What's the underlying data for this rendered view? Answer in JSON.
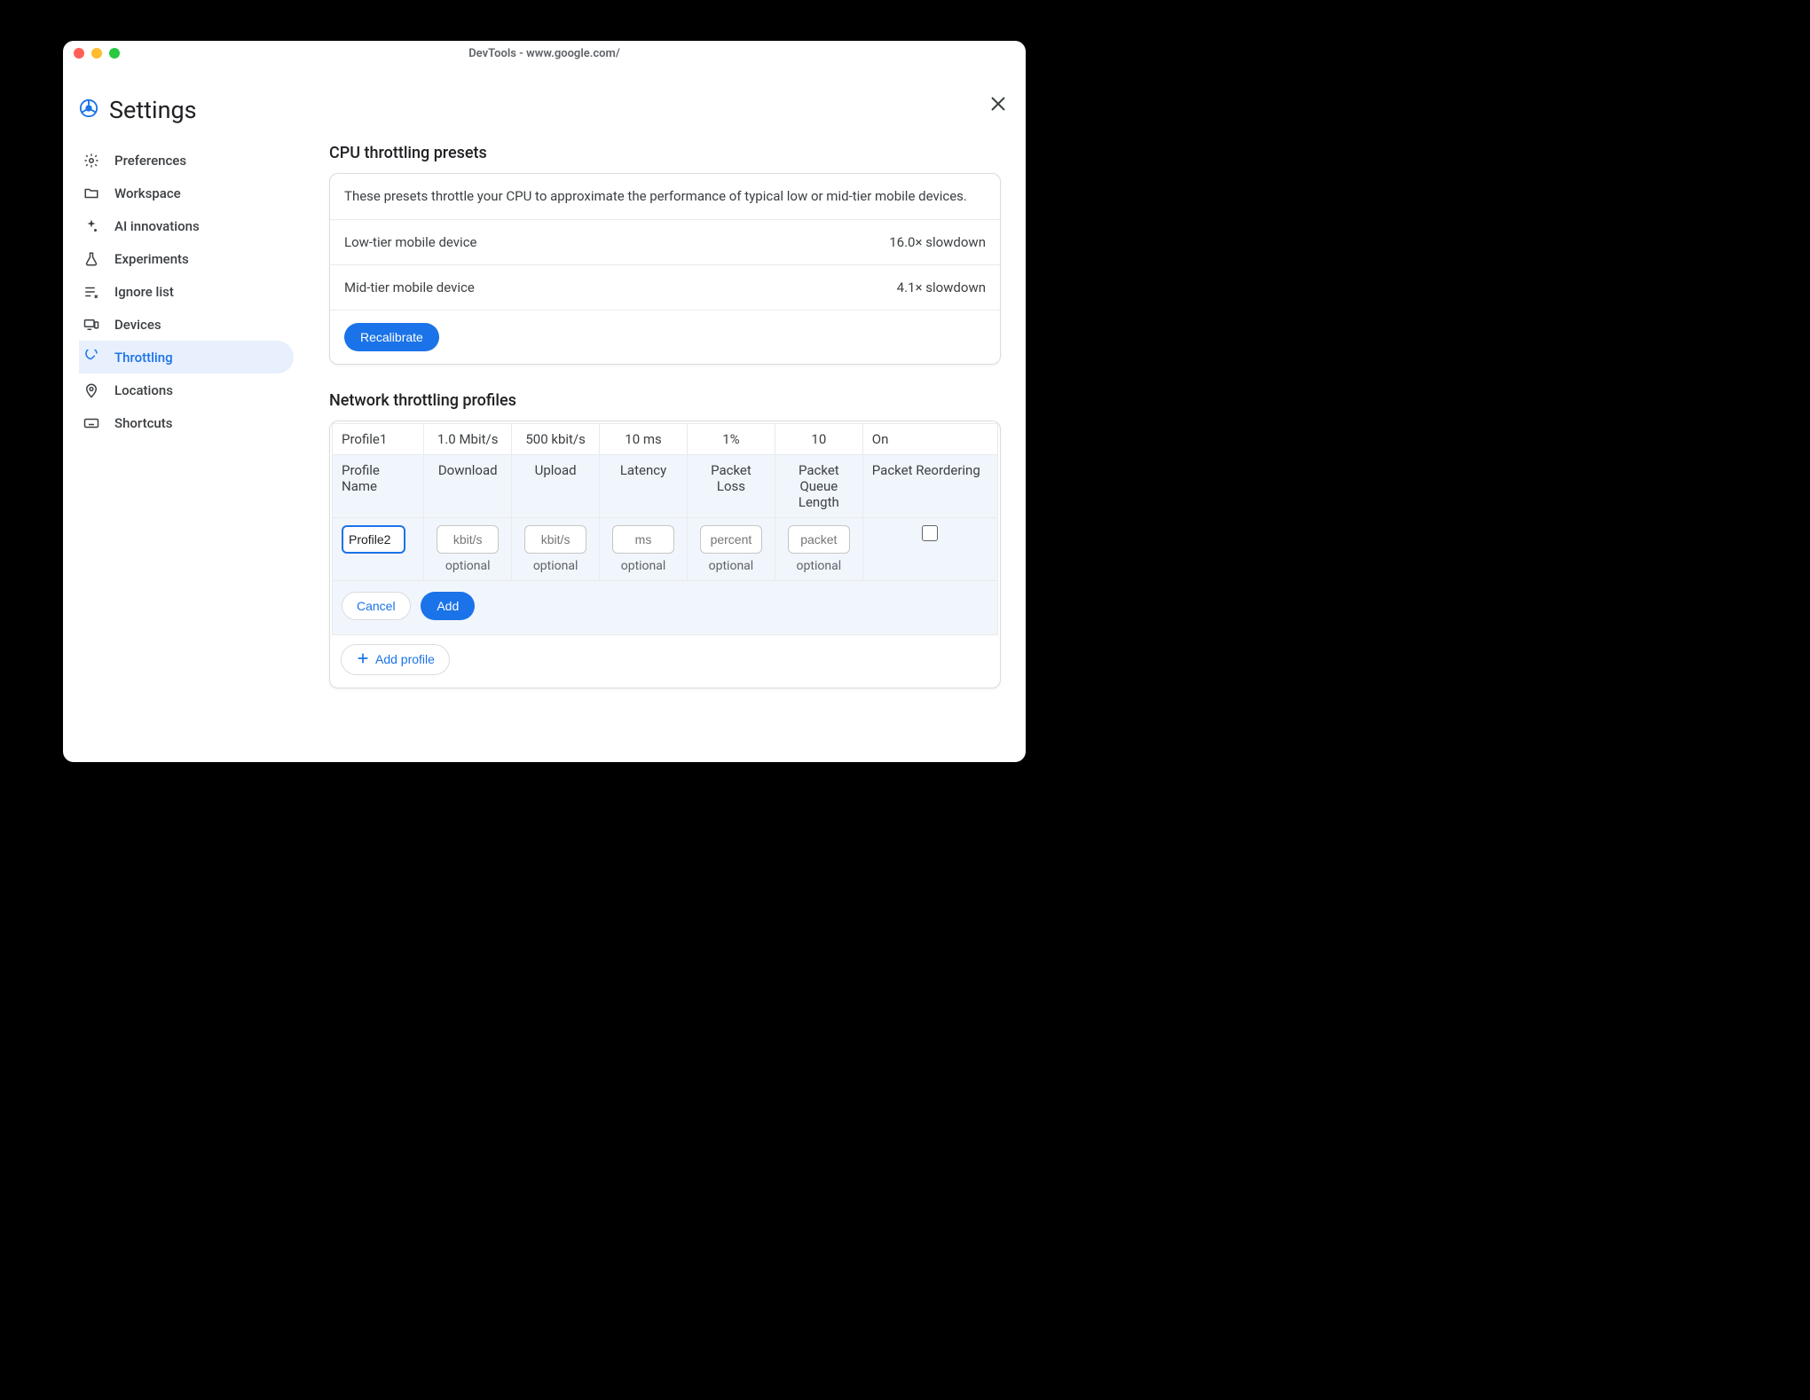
{
  "window": {
    "title": "DevTools - www.google.com/"
  },
  "header": {
    "title": "Settings"
  },
  "sidebar": {
    "items": [
      {
        "label": "Preferences",
        "active": false
      },
      {
        "label": "Workspace",
        "active": false
      },
      {
        "label": "AI innovations",
        "active": false
      },
      {
        "label": "Experiments",
        "active": false
      },
      {
        "label": "Ignore list",
        "active": false
      },
      {
        "label": "Devices",
        "active": false
      },
      {
        "label": "Throttling",
        "active": true
      },
      {
        "label": "Locations",
        "active": false
      },
      {
        "label": "Shortcuts",
        "active": false
      }
    ]
  },
  "cpu": {
    "title": "CPU throttling presets",
    "intro": "These presets throttle your CPU to approximate the performance of typical low or mid-tier mobile devices.",
    "rows": [
      {
        "name": "Low-tier mobile device",
        "value": "16.0× slowdown"
      },
      {
        "name": "Mid-tier mobile device",
        "value": "4.1× slowdown"
      }
    ],
    "recalibrate": "Recalibrate"
  },
  "network": {
    "title": "Network throttling profiles",
    "profile": {
      "name": "Profile1",
      "download": "1.0 Mbit/s",
      "upload": "500 kbit/s",
      "latency": "10 ms",
      "loss": "1%",
      "queue": "10",
      "reorder": "On"
    },
    "columns": {
      "name": "Profile Name",
      "download": "Download",
      "upload": "Upload",
      "latency": "Latency",
      "loss": "Packet Loss",
      "queue": "Packet Queue Length",
      "reorder": "Packet Reordering"
    },
    "edit": {
      "name": "Profile2",
      "ph_download": "kbit/s",
      "ph_upload": "kbit/s",
      "ph_latency": "ms",
      "ph_loss": "percent",
      "ph_queue": "packet",
      "optional": "optional"
    },
    "buttons": {
      "cancel": "Cancel",
      "add": "Add",
      "addProfile": "Add profile"
    }
  }
}
